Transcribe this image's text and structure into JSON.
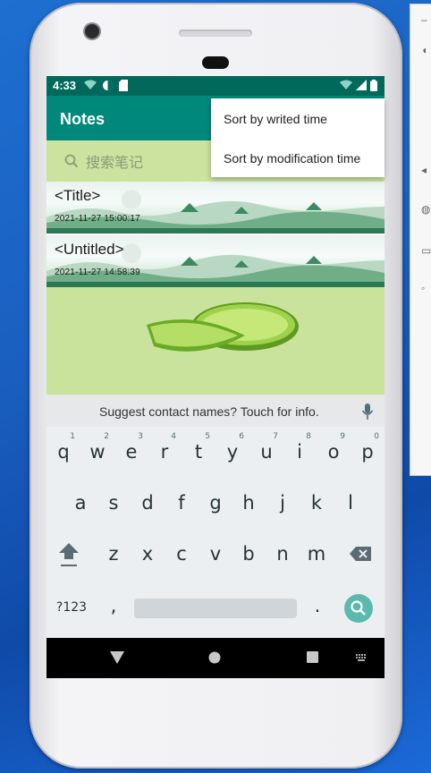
{
  "status_bar": {
    "time": "4:33"
  },
  "app_bar": {
    "title": "Notes"
  },
  "search": {
    "placeholder": "搜索笔记"
  },
  "notes": [
    {
      "title": "<Title>",
      "timestamp": "2021-11-27 15:00:17"
    },
    {
      "title": "<Untitled>",
      "timestamp": "2021-11-27 14:58:39"
    }
  ],
  "menu": {
    "items": [
      {
        "label": "Sort by writed time"
      },
      {
        "label": "Sort by modification time"
      }
    ]
  },
  "keyboard": {
    "suggestion": "Suggest contact names? Touch for info.",
    "row1": [
      {
        "key": "q",
        "hint": "1"
      },
      {
        "key": "w",
        "hint": "2"
      },
      {
        "key": "e",
        "hint": "3"
      },
      {
        "key": "r",
        "hint": "4"
      },
      {
        "key": "t",
        "hint": "5"
      },
      {
        "key": "y",
        "hint": "6"
      },
      {
        "key": "u",
        "hint": "7"
      },
      {
        "key": "i",
        "hint": "8"
      },
      {
        "key": "o",
        "hint": "9"
      },
      {
        "key": "p",
        "hint": "0"
      }
    ],
    "row2": [
      "a",
      "s",
      "d",
      "f",
      "g",
      "h",
      "j",
      "k",
      "l"
    ],
    "row3": [
      "z",
      "x",
      "c",
      "v",
      "b",
      "n",
      "m"
    ],
    "symbols_key": "?123",
    "comma_key": ",",
    "period_key": "."
  },
  "colors": {
    "status_bar": "#00695c",
    "app_bar": "#00897b",
    "search_bg": "#cbe39f",
    "content_bg": "#c9e29c",
    "enter_key": "#5bb9ad"
  },
  "icons": {
    "search": "search-icon",
    "mic": "mic-icon",
    "shift": "shift-icon",
    "backspace": "backspace-icon",
    "enter": "search-icon",
    "nav_back": "back-triangle-icon",
    "nav_home": "home-circle-icon",
    "nav_recents": "recents-square-icon",
    "keyboard_switch": "keyboard-icon"
  }
}
